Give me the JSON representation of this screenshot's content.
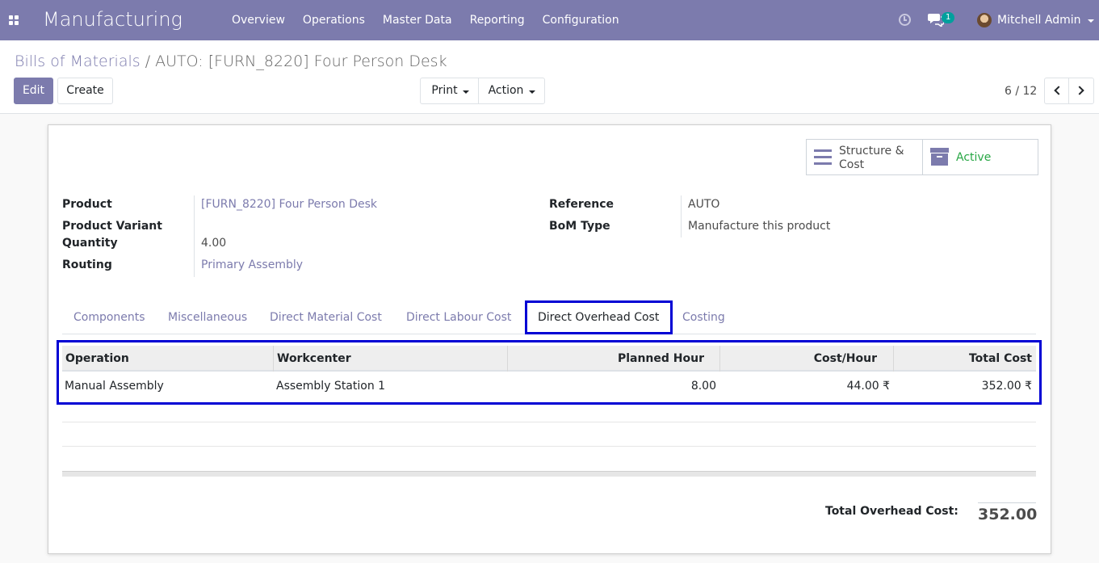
{
  "navbar": {
    "app_name": "Manufacturing",
    "menu": [
      "Overview",
      "Operations",
      "Master Data",
      "Reporting",
      "Configuration"
    ],
    "chat_badge": "1",
    "user_name": "Mitchell Admin",
    "color": "#7c7bad"
  },
  "control_panel": {
    "breadcrumb_parent": "Bills of Materials",
    "breadcrumb_separator": "/",
    "breadcrumb_current": "AUTO: [FURN_8220] Four Person Desk",
    "edit_label": "Edit",
    "create_label": "Create",
    "print_label": "Print",
    "action_label": "Action",
    "pager_value": "6 / 12"
  },
  "sheet": {
    "stat_buttons": {
      "structure_line1": "Structure &",
      "structure_line2": "Cost",
      "active_label": "Active"
    },
    "fields_left": {
      "product_label": "Product",
      "product_value": "[FURN_8220] Four Person Desk",
      "variant_label": "Product Variant",
      "quantity_label": "Quantity",
      "quantity_value": "4.00",
      "routing_label": "Routing",
      "routing_value": "Primary Assembly"
    },
    "fields_right": {
      "reference_label": "Reference",
      "reference_value": "AUTO",
      "bom_type_label": "BoM Type",
      "bom_type_value": "Manufacture this product"
    },
    "tabs": [
      "Components",
      "Miscellaneous",
      "Direct Material Cost",
      "Direct Labour Cost",
      "Direct Overhead Cost",
      "Costing"
    ],
    "active_tab": "Direct Overhead Cost",
    "table": {
      "columns": [
        "Operation",
        "Workcenter",
        "Planned Hour",
        "Cost/Hour",
        "Total Cost"
      ],
      "rows": [
        [
          "Manual Assembly",
          "Assembly Station 1",
          "8.00",
          "44.00 ₹",
          "352.00 ₹"
        ]
      ]
    },
    "total_label": "Total Overhead Cost:",
    "total_value": "352.00"
  }
}
